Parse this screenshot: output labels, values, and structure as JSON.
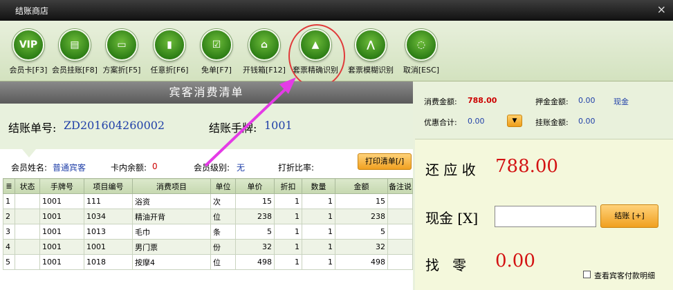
{
  "window": {
    "title": "结账商店",
    "close": "×"
  },
  "toolbar": {
    "buttons": [
      {
        "label": "会员卡[F3]",
        "glyph": "VIP"
      },
      {
        "label": "会员挂账[F8]",
        "glyph": "▤"
      },
      {
        "label": "方案折[F5]",
        "glyph": "▭"
      },
      {
        "label": "任意折[F6]",
        "glyph": "▮"
      },
      {
        "label": "免单[F7]",
        "glyph": "☑"
      },
      {
        "label": "开钱箱[F12]",
        "glyph": "⌂"
      },
      {
        "label": "套票精确识别",
        "glyph": "▲"
      },
      {
        "label": "套票模糊识别",
        "glyph": "⋀"
      },
      {
        "label": "取消[ESC]",
        "glyph": "◌"
      }
    ]
  },
  "list": {
    "title": "宾客消费清单",
    "bill_no_label": "结账单号:",
    "bill_no": "ZD201604260002",
    "tag_label": "结账手牌:",
    "tag_no": "1001",
    "member_name_label": "会员姓名:",
    "member_name": "普通宾客",
    "card_balance_label": "卡内余额:",
    "card_balance": "0",
    "member_level_label": "会员级别:",
    "member_level": "无",
    "discount_label": "打折比率:",
    "discount": "",
    "print_button": "打印清单[/]"
  },
  "table": {
    "headers": [
      "≣",
      "状态",
      "手牌号",
      "项目编号",
      "消费项目",
      "单位",
      "单价",
      "折扣",
      "数量",
      "金额",
      "备注说"
    ],
    "rows": [
      [
        "1",
        "",
        "1001",
        "111",
        "浴资",
        "次",
        "15",
        "1",
        "1",
        "15",
        ""
      ],
      [
        "2",
        "",
        "1001",
        "1034",
        "精油开背",
        "位",
        "238",
        "1",
        "1",
        "238",
        ""
      ],
      [
        "3",
        "",
        "1001",
        "1013",
        "毛巾",
        "条",
        "5",
        "1",
        "1",
        "5",
        ""
      ],
      [
        "4",
        "",
        "1001",
        "1001",
        "男门票",
        "份",
        "32",
        "1",
        "1",
        "32",
        ""
      ],
      [
        "5",
        "",
        "1001",
        "1018",
        "按摩4",
        "位",
        "498",
        "1",
        "1",
        "498",
        ""
      ]
    ]
  },
  "summary": {
    "consume_label": "消费金额:",
    "consume": "788.00",
    "deposit_label": "押金金额:",
    "deposit": "0.00",
    "cash": "现金",
    "discount_total_label": "优惠合计:",
    "discount_total": "0.00",
    "credit_label": "挂账金额:",
    "credit": "0.00",
    "dropdown": "▼"
  },
  "payment": {
    "due_label": "还 应 收",
    "due": "788.00",
    "cash_label": "现金 [X]",
    "cash_value": "",
    "pay_button": "结账 [+]",
    "change_label": "找   零",
    "change": "0.00",
    "detail_checkbox": "查看宾客付款明细"
  }
}
